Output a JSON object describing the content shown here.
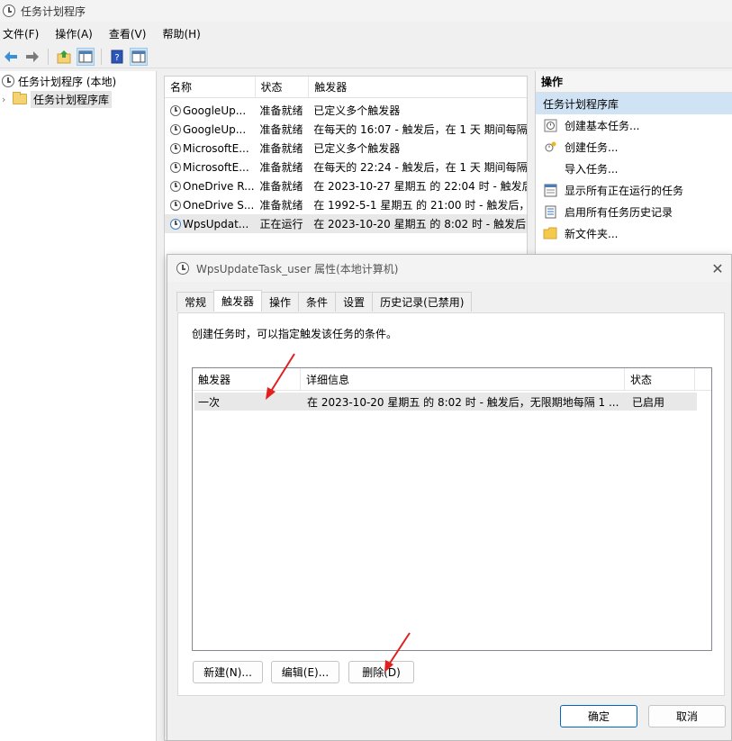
{
  "window": {
    "title": "任务计划程序"
  },
  "menu": [
    "文件(F)",
    "操作(A)",
    "查看(V)",
    "帮助(H)"
  ],
  "tree": {
    "root": "任务计划程序 (本地)",
    "library": "任务计划程序库"
  },
  "task_list": {
    "columns": [
      "名称",
      "状态",
      "触发器"
    ],
    "rows": [
      {
        "name": "GoogleUp...",
        "status": "准备就绪",
        "trigger": "已定义多个触发器"
      },
      {
        "name": "GoogleUp...",
        "status": "准备就绪",
        "trigger": "在每天的 16:07 - 触发后，在 1 天 期间每隔"
      },
      {
        "name": "MicrosoftE...",
        "status": "准备就绪",
        "trigger": "已定义多个触发器"
      },
      {
        "name": "MicrosoftE...",
        "status": "准备就绪",
        "trigger": "在每天的 22:24 - 触发后，在 1 天 期间每隔"
      },
      {
        "name": "OneDrive R...",
        "status": "准备就绪",
        "trigger": "在 2023-10-27 星期五 的 22:04 时 - 触发后"
      },
      {
        "name": "OneDrive S...",
        "status": "准备就绪",
        "trigger": "在 1992-5-1 星期五 的 21:00 时 - 触发后，"
      },
      {
        "name": "WpsUpdat...",
        "status": "正在运行",
        "trigger": "在 2023-10-20 星期五 的 8:02 时 - 触发后，"
      }
    ]
  },
  "actions": {
    "header": "操作",
    "section": "任务计划程序库",
    "items": [
      {
        "label": "创建基本任务...",
        "icon": "create-basic-task-icon"
      },
      {
        "label": "创建任务...",
        "icon": "create-task-icon"
      },
      {
        "label": "导入任务...",
        "icon": ""
      },
      {
        "label": "显示所有正在运行的任务",
        "icon": "running-tasks-icon"
      },
      {
        "label": "启用所有任务历史记录",
        "icon": "history-icon"
      },
      {
        "label": "新文件夹...",
        "icon": "folder-icon"
      }
    ]
  },
  "dialog": {
    "title": "WpsUpdateTask_user 属性(本地计算机)",
    "tabs": [
      "常规",
      "触发器",
      "操作",
      "条件",
      "设置",
      "历史记录(已禁用)"
    ],
    "active_tab": "触发器",
    "description": "创建任务时，可以指定触发该任务的条件。",
    "table": {
      "columns": [
        "触发器",
        "详细信息",
        "状态"
      ],
      "rows": [
        {
          "trigger": "一次",
          "details": "在 2023-10-20 星期五 的 8:02 时 - 触发后，无限期地每隔 1 ...",
          "status": "已启用"
        }
      ]
    },
    "buttons": {
      "new": "新建(N)...",
      "edit": "编辑(E)...",
      "delete": "删除(D)",
      "ok": "确定",
      "cancel": "取消"
    }
  },
  "colors": {
    "selection": "#cfe3f4",
    "accent": "#0067c0",
    "annotation_arrow": "#e02020"
  }
}
